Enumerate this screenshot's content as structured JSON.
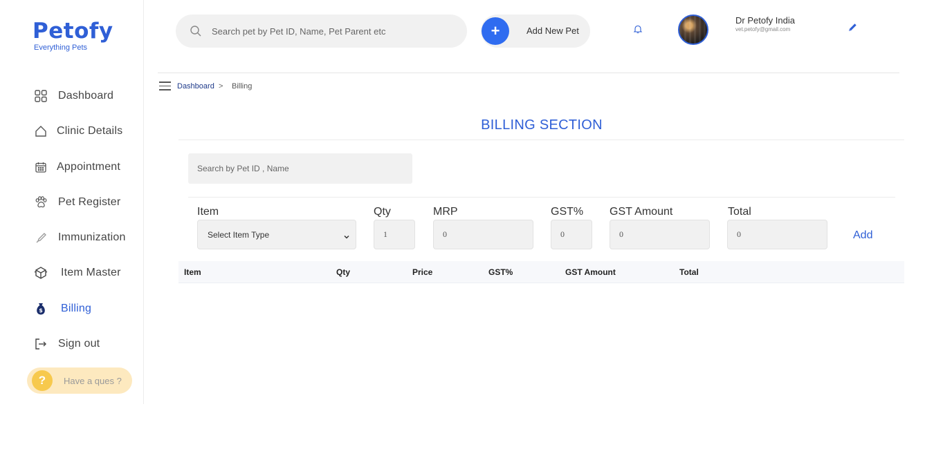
{
  "brand": {
    "name": "Petofy",
    "tagline": "Everything Pets"
  },
  "sidebar": {
    "items": [
      {
        "label": "Dashboard",
        "icon": "grid-icon"
      },
      {
        "label": "Clinic Details",
        "icon": "home-icon"
      },
      {
        "label": "Appointment",
        "icon": "calendar-icon"
      },
      {
        "label": "Pet Register",
        "icon": "paw-icon"
      },
      {
        "label": "Immunization",
        "icon": "syringe-icon"
      },
      {
        "label": "Item Master",
        "icon": "box-icon"
      },
      {
        "label": "Billing",
        "icon": "money-bag-icon",
        "active": true
      },
      {
        "label": "Sign out",
        "icon": "sign-out-icon"
      }
    ],
    "help_label": "Have a ques ?",
    "help_icon": "?"
  },
  "header": {
    "search_placeholder": "Search pet by Pet ID, Name, Pet Parent etc",
    "add_pet_label": "Add New Pet",
    "add_pet_icon": "+",
    "user_name": "Dr Petofy India",
    "user_email": "vet.petofy@gmail.com"
  },
  "breadcrumb": {
    "home": "Dashboard",
    "separator": ">",
    "current": "Billing"
  },
  "billing": {
    "title": "BILLING SECTION",
    "search_placeholder": "Search by Pet ID , Name",
    "form": {
      "item_label": "Item",
      "item_select_value": "Select Item Type",
      "qty_label": "Qty",
      "qty_value": "1",
      "mrp_label": "MRP",
      "mrp_value": "0",
      "gst_pct_label": "GST%",
      "gst_pct_value": "0",
      "gst_amount_label": "GST Amount",
      "gst_amount_value": "0",
      "total_label": "Total",
      "total_value": "0",
      "add_label": "Add"
    },
    "table_headers": [
      "Item",
      "Qty",
      "Price",
      "GST%",
      "GST Amount",
      "Total"
    ]
  },
  "colors": {
    "accent": "#2f5fd6",
    "button_blue": "#2f6cf0",
    "help_bg": "#fde9bf",
    "help_icon": "#f7c94d"
  }
}
